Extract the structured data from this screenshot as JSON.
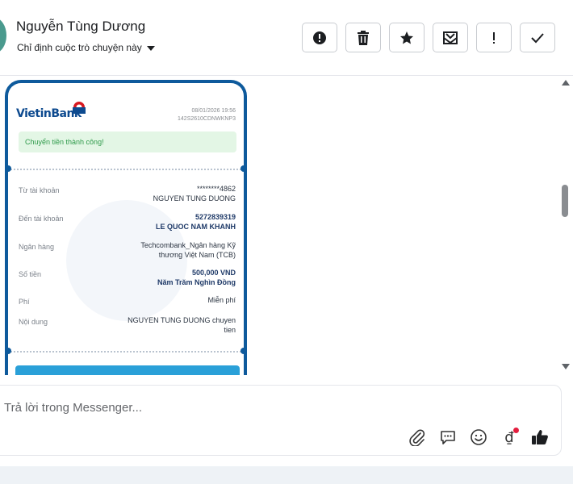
{
  "header": {
    "contact_name": "Nguyễn Tùng Dương",
    "assign_label": "Chỉ định cuộc trò chuyện này",
    "toolbar": [
      {
        "name": "report-spam-button",
        "icon": "exclamation-circle-icon"
      },
      {
        "name": "delete-button",
        "icon": "trash-icon"
      },
      {
        "name": "star-button",
        "icon": "star-icon"
      },
      {
        "name": "mark-unread-button",
        "icon": "envelope-icon"
      },
      {
        "name": "follow-up-button",
        "icon": "exclamation-icon"
      },
      {
        "name": "mark-done-button",
        "icon": "checkmark-icon"
      }
    ]
  },
  "receipt": {
    "bank_logo": "VietinBank",
    "date": "08/01/2026 19:56",
    "ref": "142S2610CDNWKNP3",
    "status": "Chuyển tiền thành công!",
    "rows": [
      {
        "label": "Từ tài khoản",
        "value": "********4862",
        "value2": "NGUYEN TUNG DUONG"
      },
      {
        "label": "Đến tài khoản",
        "value": "5272839319",
        "value2": "LE QUOC NAM KHANH"
      },
      {
        "label": "Ngân hàng",
        "value": "Techcombank_Ngân hàng Kỹ",
        "value2": "thương Việt Nam (TCB)"
      },
      {
        "label": "Số tiền",
        "value": "500,000 VND",
        "value2": "Năm Trăm Nghìn Đồng"
      },
      {
        "label": "Phí",
        "value": "Miễn phí",
        "value2": ""
      },
      {
        "label": "Nội dung",
        "value": "NGUYEN TUNG DUONG chuyen",
        "value2": "tien"
      }
    ]
  },
  "reply": {
    "placeholder": "Trả lời trong Messenger...",
    "value": ""
  },
  "colors": {
    "brand_blue": "#0e5a9c",
    "success_green": "#2e9a4a",
    "notification_red": "#e41e3f"
  }
}
